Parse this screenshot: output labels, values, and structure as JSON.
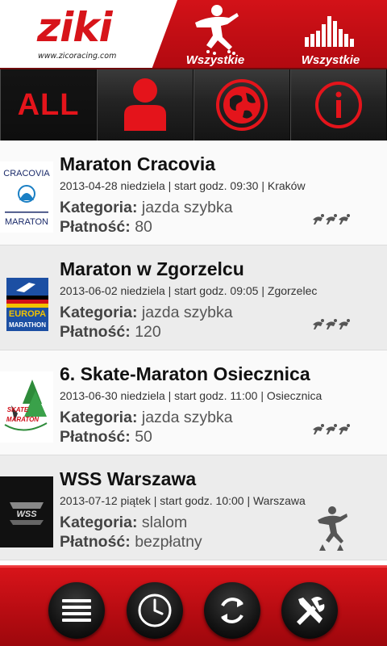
{
  "header": {
    "logo": "ziki",
    "logo_url": "www.zicoracing.com",
    "tabs": [
      {
        "label": "Wszystkie",
        "icon": "skater-icon"
      },
      {
        "label": "Wszystkie",
        "icon": "level-bars-icon"
      }
    ]
  },
  "filters": [
    {
      "label": "ALL",
      "icon": "all-text"
    },
    {
      "icon": "person-icon"
    },
    {
      "icon": "globe-icon"
    },
    {
      "icon": "info-icon"
    }
  ],
  "events": [
    {
      "title": "Maraton Cracovia",
      "meta": "2013-04-28 niedziela | start godz.  09:30 | Kraków",
      "category_label": "Kategoria:",
      "category": "jazda szybka",
      "payment_label": "Płatność:",
      "payment": "80",
      "thumb": {
        "top": "CRACOVIA",
        "bottom": "MARATON"
      },
      "discipline_icon": "speed-skaters-icon"
    },
    {
      "title": "Maraton w Zgorzelcu",
      "meta": "2013-06-02 niedziela | start godz.  09:05 | Zgorzelec",
      "category_label": "Kategoria:",
      "category": "jazda szybka",
      "payment_label": "Płatność:",
      "payment": "120",
      "thumb": {
        "top": "EUROPA",
        "bottom": "MARATHON"
      },
      "discipline_icon": "speed-skaters-icon"
    },
    {
      "title": "6. Skate-Maraton Osiecznica",
      "meta": "2013-06-30 niedziela | start godz.  11:00 | Osiecznica",
      "category_label": "Kategoria:",
      "category": "jazda szybka",
      "payment_label": "Płatność:",
      "payment": "50",
      "thumb": {
        "top": "SKATE",
        "bottom": "MARATON"
      },
      "discipline_icon": "speed-skaters-icon"
    },
    {
      "title": "WSS Warszawa",
      "meta": "2013-07-12 piątek | start godz.  10:00 | Warszawa",
      "category_label": "Kategoria:",
      "category": "slalom",
      "payment_label": "Płatność:",
      "payment": "bezpłatny",
      "thumb": {
        "top": "WSS",
        "bottom": ""
      },
      "discipline_icon": "slalom-skater-icon"
    }
  ],
  "bottom_bar": [
    {
      "icon": "list-icon"
    },
    {
      "icon": "clock-icon"
    },
    {
      "icon": "refresh-icon"
    },
    {
      "icon": "tools-icon"
    }
  ],
  "colors": {
    "brand_red": "#d31218",
    "dark_bar": "#1b1b1b",
    "text_dark": "#111111"
  }
}
